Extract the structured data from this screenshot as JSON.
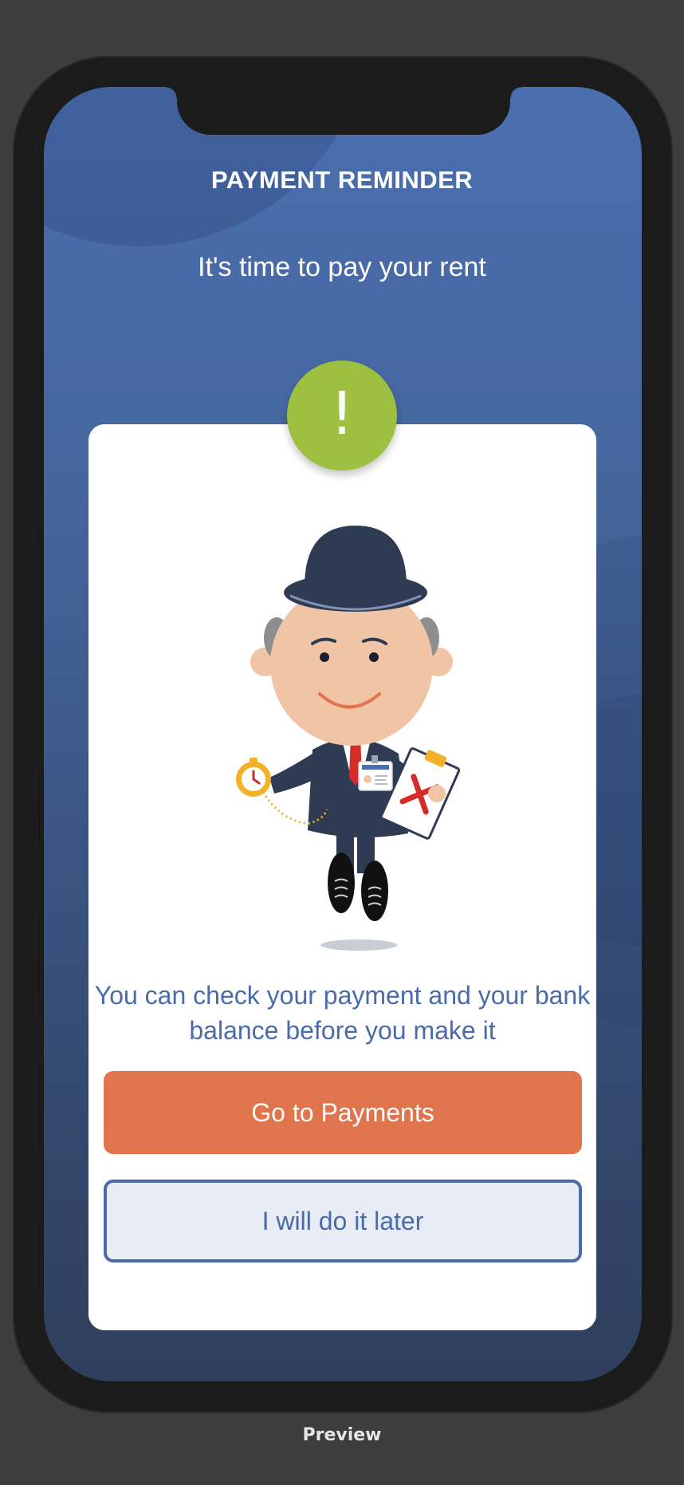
{
  "header": {
    "title": "PAYMENT REMINDER",
    "subtitle": "It's time to pay your rent"
  },
  "alert": {
    "icon": "exclamation-icon",
    "glyph": "!",
    "color": "#9dc040"
  },
  "illustration": {
    "name": "bowler-hat-man-with-stopwatch-and-clipboard"
  },
  "card": {
    "message": "You can check your payment and your bank balance before you make it",
    "primary_button": "Go to Payments",
    "secondary_button": "I will do it later"
  },
  "footer": {
    "label": "Preview"
  },
  "colors": {
    "primary": "#e0744c",
    "accent_text": "#4a6aaa",
    "background_top": "#4a6eaf",
    "background_bottom": "#2f3f5c"
  }
}
